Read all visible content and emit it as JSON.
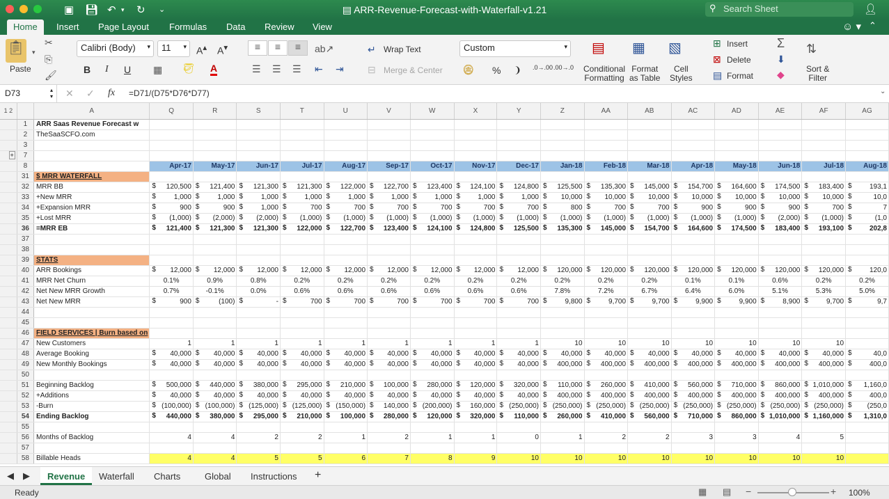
{
  "window": {
    "title": "ARR-Revenue-Forecast-with-Waterfall-v1.21",
    "search_placeholder": "Search Sheet"
  },
  "ribbon_tabs": [
    "Home",
    "Insert",
    "Page Layout",
    "Formulas",
    "Data",
    "Review",
    "View"
  ],
  "ribbon": {
    "paste": "Paste",
    "font_name": "Calibri (Body)",
    "font_size": "11",
    "bold": "B",
    "italic": "I",
    "underline": "U",
    "wrap_text": "Wrap Text",
    "merge_center": "Merge & Center",
    "number_format": "Custom",
    "percent": "%",
    "comma": "❩",
    "inc_decimal": ".0→.00",
    "dec_decimal": ".00→.0",
    "conditional_formatting": [
      "Conditional",
      "Formatting"
    ],
    "format_as_table": [
      "Format",
      "as Table"
    ],
    "cell_styles": [
      "Cell",
      "Styles"
    ],
    "insert": "Insert",
    "delete": "Delete",
    "format": "Format",
    "sort_filter": [
      "Sort &",
      "Filter"
    ]
  },
  "formula_bar": {
    "name_box": "D73",
    "fx": "fx",
    "formula": "=D71/(D75*D76*D77)"
  },
  "outline_levels": [
    "1",
    "2"
  ],
  "columns": [
    "A",
    "Q",
    "R",
    "S",
    "T",
    "U",
    "V",
    "W",
    "X",
    "Y",
    "Z",
    "AA",
    "AB",
    "AC",
    "AD",
    "AE",
    "AF",
    "AG"
  ],
  "rows": [
    {
      "n": "1",
      "type": "title",
      "a": "ARR Saas Revenue Forecast w",
      "c": []
    },
    {
      "n": "2",
      "type": "plain",
      "a": "TheSaaSCFO.com",
      "c": []
    },
    {
      "n": "3",
      "type": "plain",
      "a": "",
      "c": []
    },
    {
      "n": "7",
      "type": "plain",
      "a": "",
      "c": []
    },
    {
      "n": "8",
      "type": "mo",
      "a": "",
      "c": [
        "Apr-17",
        "May-17",
        "Jun-17",
        "Jul-17",
        "Aug-17",
        "Sep-17",
        "Oct-17",
        "Nov-17",
        "Dec-17",
        "Jan-18",
        "Feb-18",
        "Mar-18",
        "Apr-18",
        "May-18",
        "Jun-18",
        "Jul-18",
        "Aug-18"
      ]
    },
    {
      "n": "31",
      "type": "sec",
      "a": "$ MRR WATERFALL",
      "c": []
    },
    {
      "n": "32",
      "type": "money",
      "a": "MRR BB",
      "c": [
        "120,500",
        "121,400",
        "121,300",
        "121,300",
        "122,000",
        "122,700",
        "123,400",
        "124,100",
        "124,800",
        "125,500",
        "135,300",
        "145,000",
        "154,700",
        "164,600",
        "174,500",
        "183,400",
        "193,1"
      ]
    },
    {
      "n": "33",
      "type": "money",
      "a": "+New MRR",
      "c": [
        "1,000",
        "1,000",
        "1,000",
        "1,000",
        "1,000",
        "1,000",
        "1,000",
        "1,000",
        "1,000",
        "10,000",
        "10,000",
        "10,000",
        "10,000",
        "10,000",
        "10,000",
        "10,000",
        "10,0"
      ]
    },
    {
      "n": "34",
      "type": "money",
      "a": "+Expansion MRR",
      "c": [
        "900",
        "900",
        "1,000",
        "700",
        "700",
        "700",
        "700",
        "700",
        "700",
        "800",
        "700",
        "700",
        "900",
        "900",
        "900",
        "700",
        "7"
      ]
    },
    {
      "n": "35",
      "type": "money",
      "a": "+Lost MRR",
      "c": [
        "(1,000)",
        "(2,000)",
        "(2,000)",
        "(1,000)",
        "(1,000)",
        "(1,000)",
        "(1,000)",
        "(1,000)",
        "(1,000)",
        "(1,000)",
        "(1,000)",
        "(1,000)",
        "(1,000)",
        "(1,000)",
        "(2,000)",
        "(1,000)",
        "(1,0"
      ]
    },
    {
      "n": "36",
      "type": "money bold",
      "a": "=MRR EB",
      "c": [
        "121,400",
        "121,300",
        "121,300",
        "122,000",
        "122,700",
        "123,400",
        "124,100",
        "124,800",
        "125,500",
        "135,300",
        "145,000",
        "154,700",
        "164,600",
        "174,500",
        "183,400",
        "193,100",
        "202,8"
      ]
    },
    {
      "n": "37",
      "type": "plain",
      "a": "",
      "c": []
    },
    {
      "n": "38",
      "type": "plain",
      "a": "",
      "c": []
    },
    {
      "n": "39",
      "type": "sec",
      "a": "STATS",
      "c": []
    },
    {
      "n": "40",
      "type": "money",
      "a": "ARR Bookings",
      "c": [
        "12,000",
        "12,000",
        "12,000",
        "12,000",
        "12,000",
        "12,000",
        "12,000",
        "12,000",
        "12,000",
        "120,000",
        "120,000",
        "120,000",
        "120,000",
        "120,000",
        "120,000",
        "120,000",
        "120,0"
      ]
    },
    {
      "n": "41",
      "type": "pct",
      "a": "MRR Net Churn",
      "c": [
        "0.1%",
        "0.9%",
        "0.8%",
        "0.2%",
        "0.2%",
        "0.2%",
        "0.2%",
        "0.2%",
        "0.2%",
        "0.2%",
        "0.2%",
        "0.2%",
        "0.1%",
        "0.1%",
        "0.6%",
        "0.2%",
        "0.2%"
      ]
    },
    {
      "n": "42",
      "type": "pct",
      "a": "Net New MRR Growth",
      "c": [
        "0.7%",
        "-0.1%",
        "0.0%",
        "0.6%",
        "0.6%",
        "0.6%",
        "0.6%",
        "0.6%",
        "0.6%",
        "7.8%",
        "7.2%",
        "6.7%",
        "6.4%",
        "6.0%",
        "5.1%",
        "5.3%",
        "5.0%"
      ]
    },
    {
      "n": "43",
      "type": "money",
      "a": "Net New MRR",
      "c": [
        "900",
        "(100)",
        "-",
        "700",
        "700",
        "700",
        "700",
        "700",
        "700",
        "9,800",
        "9,700",
        "9,700",
        "9,900",
        "9,900",
        "8,900",
        "9,700",
        "9,7"
      ]
    },
    {
      "n": "44",
      "type": "plain",
      "a": "",
      "c": []
    },
    {
      "n": "45",
      "type": "plain",
      "a": "",
      "c": []
    },
    {
      "n": "46",
      "type": "sec",
      "a": "FIELD SERVICES | Burn based on",
      "c": []
    },
    {
      "n": "47",
      "type": "num",
      "a": "New Customers",
      "c": [
        "1",
        "1",
        "1",
        "1",
        "1",
        "1",
        "1",
        "1",
        "1",
        "10",
        "10",
        "10",
        "10",
        "10",
        "10",
        "10",
        ""
      ]
    },
    {
      "n": "48",
      "type": "money",
      "a": "Average Booking",
      "c": [
        "40,000",
        "40,000",
        "40,000",
        "40,000",
        "40,000",
        "40,000",
        "40,000",
        "40,000",
        "40,000",
        "40,000",
        "40,000",
        "40,000",
        "40,000",
        "40,000",
        "40,000",
        "40,000",
        "40,0"
      ]
    },
    {
      "n": "49",
      "type": "money",
      "a": "New Monthly Bookings",
      "c": [
        "40,000",
        "40,000",
        "40,000",
        "40,000",
        "40,000",
        "40,000",
        "40,000",
        "40,000",
        "40,000",
        "400,000",
        "400,000",
        "400,000",
        "400,000",
        "400,000",
        "400,000",
        "400,000",
        "400,0"
      ]
    },
    {
      "n": "50",
      "type": "plain",
      "a": "",
      "c": []
    },
    {
      "n": "51",
      "type": "money",
      "a": "Beginning Backlog",
      "c": [
        "500,000",
        "440,000",
        "380,000",
        "295,000",
        "210,000",
        "100,000",
        "280,000",
        "120,000",
        "320,000",
        "110,000",
        "260,000",
        "410,000",
        "560,000",
        "710,000",
        "860,000",
        "1,010,000",
        "1,160,0"
      ]
    },
    {
      "n": "52",
      "type": "money",
      "a": "+Additions",
      "c": [
        "40,000",
        "40,000",
        "40,000",
        "40,000",
        "40,000",
        "40,000",
        "40,000",
        "40,000",
        "40,000",
        "400,000",
        "400,000",
        "400,000",
        "400,000",
        "400,000",
        "400,000",
        "400,000",
        "400,0"
      ]
    },
    {
      "n": "53",
      "type": "money",
      "a": "-Burn",
      "c": [
        "(100,000)",
        "(100,000)",
        "(125,000)",
        "(125,000)",
        "(150,000)",
        "140,000",
        "(200,000)",
        "160,000",
        "(250,000)",
        "(250,000)",
        "(250,000)",
        "(250,000)",
        "(250,000)",
        "(250,000)",
        "(250,000)",
        "(250,000)",
        "(250,0"
      ]
    },
    {
      "n": "54",
      "type": "money bold",
      "a": "Ending Backlog",
      "c": [
        "440,000",
        "380,000",
        "295,000",
        "210,000",
        "100,000",
        "280,000",
        "120,000",
        "320,000",
        "110,000",
        "260,000",
        "410,000",
        "560,000",
        "710,000",
        "860,000",
        "1,010,000",
        "1,160,000",
        "1,310,0"
      ]
    },
    {
      "n": "55",
      "type": "plain",
      "a": "",
      "c": []
    },
    {
      "n": "56",
      "type": "num",
      "a": "Months of Backlog",
      "c": [
        "4",
        "4",
        "2",
        "2",
        "1",
        "2",
        "1",
        "1",
        "0",
        "1",
        "2",
        "2",
        "3",
        "3",
        "4",
        "5",
        ""
      ]
    },
    {
      "n": "57",
      "type": "plain",
      "a": "",
      "c": []
    },
    {
      "n": "58",
      "type": "num yel",
      "a": "Billable Heads",
      "c": [
        "4",
        "4",
        "5",
        "5",
        "6",
        "7",
        "8",
        "9",
        "10",
        "10",
        "10",
        "10",
        "10",
        "10",
        "10",
        "10",
        ""
      ]
    }
  ],
  "sheet_tabs": [
    "Revenue",
    "Waterfall",
    "Charts",
    "Global",
    "Instructions"
  ],
  "add_sheet": "+",
  "status": {
    "ready": "Ready",
    "zoom": "100%"
  }
}
